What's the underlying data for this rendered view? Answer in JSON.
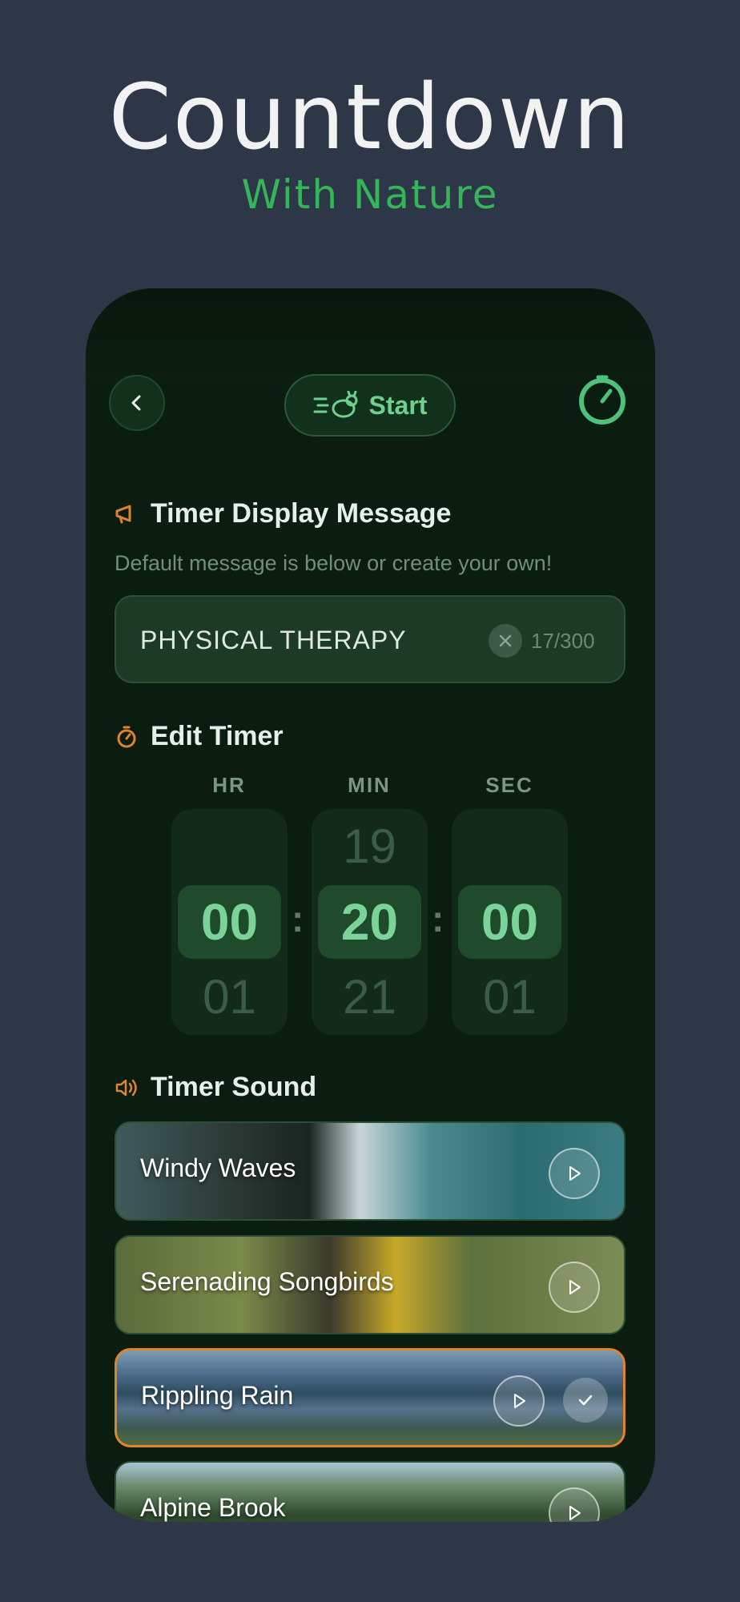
{
  "hero": {
    "title": "Countdown",
    "subtitle": "With Nature"
  },
  "header": {
    "back_icon": "chevron-left-icon",
    "start_label": "Start",
    "start_icon": "list-rabbit-icon",
    "timer_icon": "stopwatch-icon"
  },
  "message_section": {
    "title": "Timer Display Message",
    "hint": "Default message is below or create your own!",
    "value": "PHYSICAL THERAPY",
    "count": "17/300"
  },
  "timer_section": {
    "title": "Edit Timer",
    "columns": [
      {
        "label": "HR",
        "prev": "",
        "current": "00",
        "next": "01"
      },
      {
        "label": "MIN",
        "prev": "19",
        "current": "20",
        "next": "21"
      },
      {
        "label": "SEC",
        "prev": "",
        "current": "00",
        "next": "01"
      }
    ],
    "separator": ":"
  },
  "sound_section": {
    "title": "Timer Sound",
    "sounds": [
      {
        "name": "Windy Waves",
        "selected": false
      },
      {
        "name": "Serenading Songbirds",
        "selected": false
      },
      {
        "name": "Rippling Rain",
        "selected": true
      },
      {
        "name": "Alpine Brook",
        "selected": false
      }
    ]
  },
  "colors": {
    "background": "#2d3748",
    "accent_green": "#35b55a",
    "accent_orange": "#e0842c",
    "phone_bg": "#0b1d10"
  }
}
